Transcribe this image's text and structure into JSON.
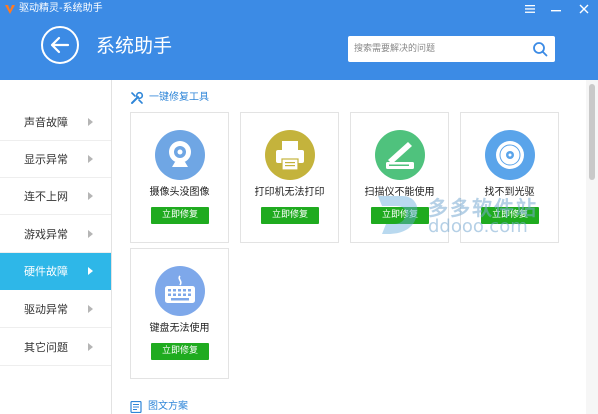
{
  "window": {
    "title": "驱动精灵-系统助手"
  },
  "header": {
    "page_title": "系统助手",
    "search_placeholder": "搜索需要解决的问题"
  },
  "sidebar": {
    "items": [
      {
        "label": "声音故障",
        "active": false
      },
      {
        "label": "显示异常",
        "active": false
      },
      {
        "label": "连不上网",
        "active": false
      },
      {
        "label": "游戏异常",
        "active": false
      },
      {
        "label": "硬件故障",
        "active": true
      },
      {
        "label": "驱动异常",
        "active": false
      },
      {
        "label": "其它问题",
        "active": false
      }
    ]
  },
  "main": {
    "repair_section_title": "一键修复工具",
    "article_section_title": "图文方案",
    "tools": [
      {
        "label": "摄像头没图像",
        "button": "立即修复",
        "icon": "webcam-icon",
        "color": "#6fa6e4"
      },
      {
        "label": "打印机无法打印",
        "button": "立即修复",
        "icon": "printer-icon",
        "color": "#c4b33c"
      },
      {
        "label": "扫描仪不能使用",
        "button": "立即修复",
        "icon": "scanner-icon",
        "color": "#4fc27d"
      },
      {
        "label": "找不到光驱",
        "button": "立即修复",
        "icon": "cd-drive-icon",
        "color": "#5aa4ea"
      },
      {
        "label": "键盘无法使用",
        "button": "立即修复",
        "icon": "keyboard-icon",
        "color": "#7ea8ea"
      }
    ]
  },
  "watermark": {
    "text_cn": "多多软件站",
    "text_url": "ddooo.com"
  },
  "colors": {
    "header_bg": "#3c8be5",
    "active_item": "#2eb7e8",
    "repair_button": "#1fab1f",
    "section_title": "#2f86d8"
  }
}
